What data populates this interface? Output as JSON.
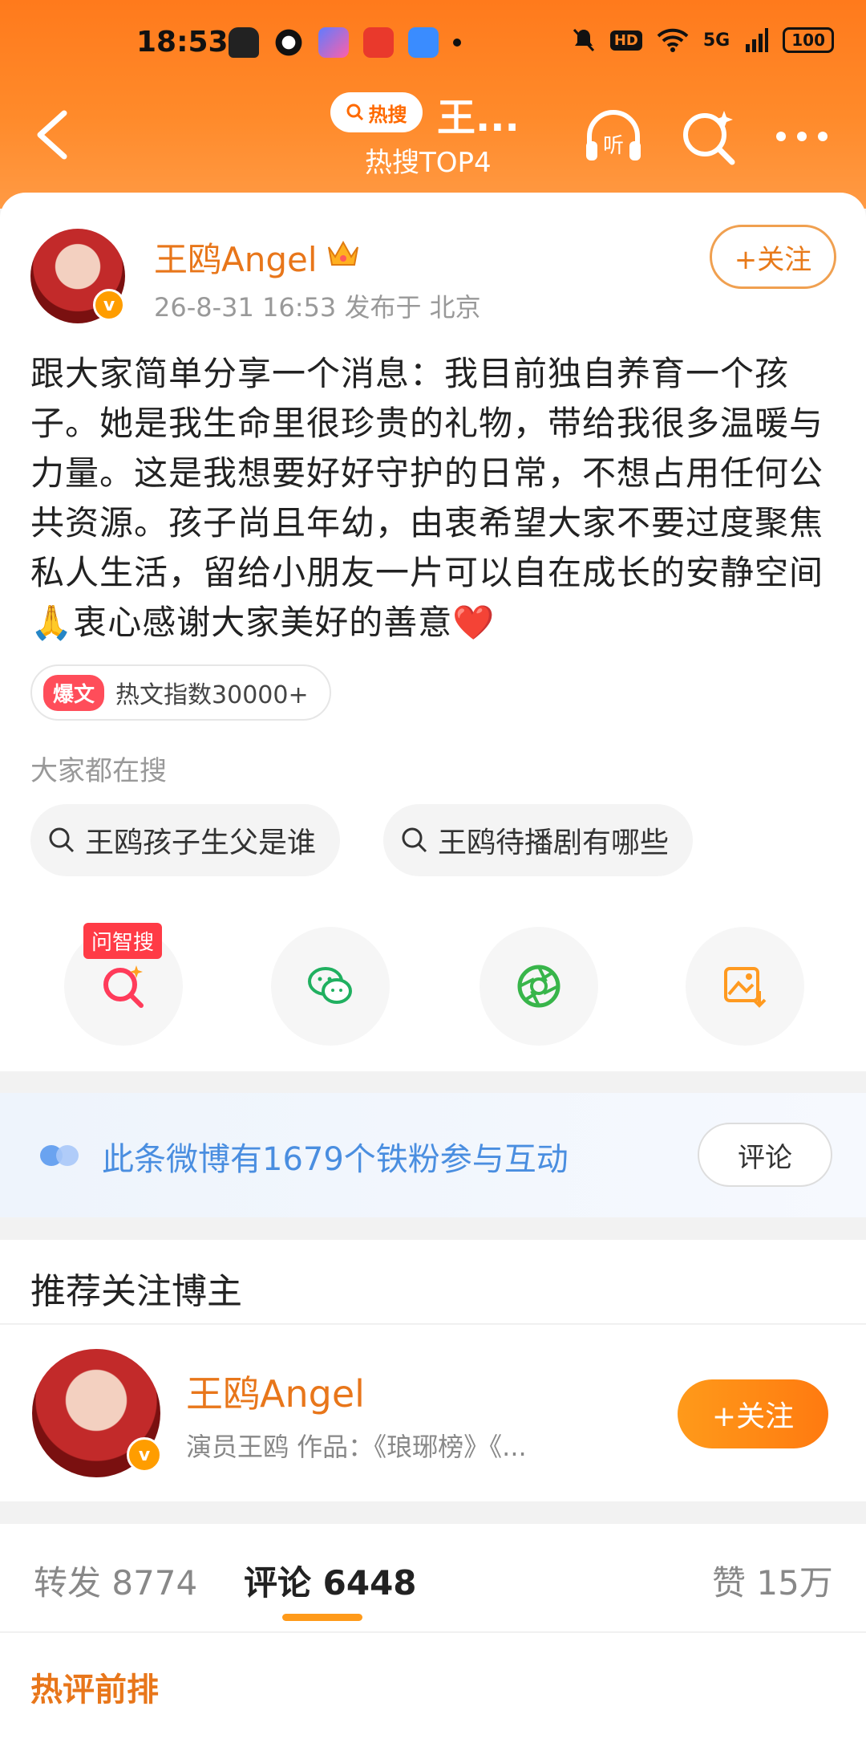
{
  "status_bar": {
    "time": "18:53",
    "battery": "100",
    "network": "5G",
    "hd": "HD"
  },
  "nav": {
    "hot_search_tag": "热搜",
    "title": "王...",
    "subtitle": "热搜TOP4",
    "listen": "听"
  },
  "post": {
    "author": "王鸥Angel",
    "meta": "26-8-31 16:53  发布于 北京",
    "follow_label": "+关注",
    "verified_mark": "v",
    "content": "跟大家简单分享一个消息：我目前独自养育一个孩子。她是我生命里很珍贵的礼物，带给我很多温暖与力量。这是我想要好好守护的日常，不想占用任何公共资源。孩子尚且年幼，由衷希望大家不要过度聚焦私人生活，留给小朋友一片可以自在成长的安静空间🙏衷心感谢大家美好的善意❤️",
    "badge_label": "爆文",
    "heat_text": "热文指数30000+",
    "search_header": "大家都在搜",
    "search_chips": [
      "王鸥孩子生父是谁",
      "王鸥待播剧有哪些"
    ],
    "ask_badge": "问智搜"
  },
  "fans": {
    "text": "此条微博有1679个铁粉参与互动",
    "button": "评论"
  },
  "recommend": {
    "header": "推荐关注博主",
    "name": "王鸥Angel",
    "desc": "演员王鸥 作品：《琅琊榜》《...",
    "follow_label": "+关注"
  },
  "tabs": {
    "repost": "转发 8774",
    "comments": "评论 6448",
    "likes": "赞 15万"
  },
  "hot_comments": {
    "header": "热评前排"
  },
  "colors": {
    "header": "#ff7a1c",
    "accent": "#e8761a",
    "link_blue": "#4a8ee0"
  }
}
